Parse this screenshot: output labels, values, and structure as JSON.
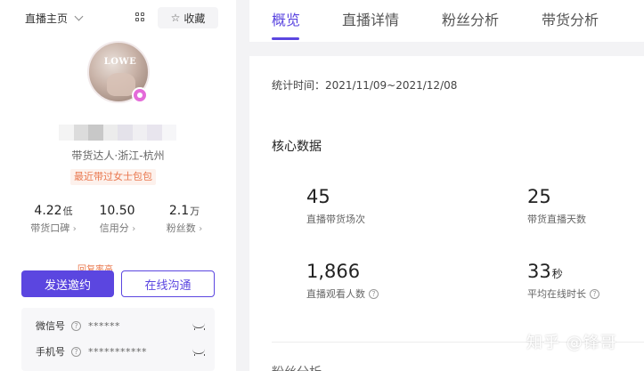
{
  "sidebar": {
    "home_select": "直播主页",
    "favorite_label": "收藏",
    "profile": {
      "tags": "带货达人·浙江-杭州",
      "recent_tag": "最近带过女士包包"
    },
    "stats": [
      {
        "value": "4.22",
        "unit": "低",
        "label": "带货口碑"
      },
      {
        "value": "10.50",
        "unit": "",
        "label": "信用分"
      },
      {
        "value": "2.1",
        "unit": "万",
        "label": "粉丝数"
      }
    ],
    "reply_rate_label": "回复率高",
    "invite_button": "发送邀约",
    "chat_button": "在线沟通",
    "contacts": [
      {
        "label": "微信号",
        "value": "******"
      },
      {
        "label": "手机号",
        "value": "***********"
      }
    ]
  },
  "tabs": [
    {
      "label": "概览",
      "active": true
    },
    {
      "label": "直播详情",
      "active": false
    },
    {
      "label": "粉丝分析",
      "active": false
    },
    {
      "label": "带货分析",
      "active": false
    }
  ],
  "overview": {
    "stat_time": "统计时间：2021/11/09~2021/12/08",
    "core_title": "核心数据",
    "kpis": [
      {
        "value": "45",
        "unit": "",
        "label": "直播带货场次",
        "help": false
      },
      {
        "value": "25",
        "unit": "",
        "label": "带货直播天数",
        "help": false
      },
      {
        "value": "1,866",
        "unit": "",
        "label": "直播观看人数",
        "help": true
      },
      {
        "value": "33",
        "unit": "秒",
        "label": "平均在线时长",
        "help": true
      }
    ],
    "next_section_title": "粉丝分析"
  },
  "watermark": "知乎 @锋哥",
  "colors": {
    "accent": "#5b46e0",
    "tag_orange": "#e9784f",
    "badge_pink": "#e46bd9"
  }
}
